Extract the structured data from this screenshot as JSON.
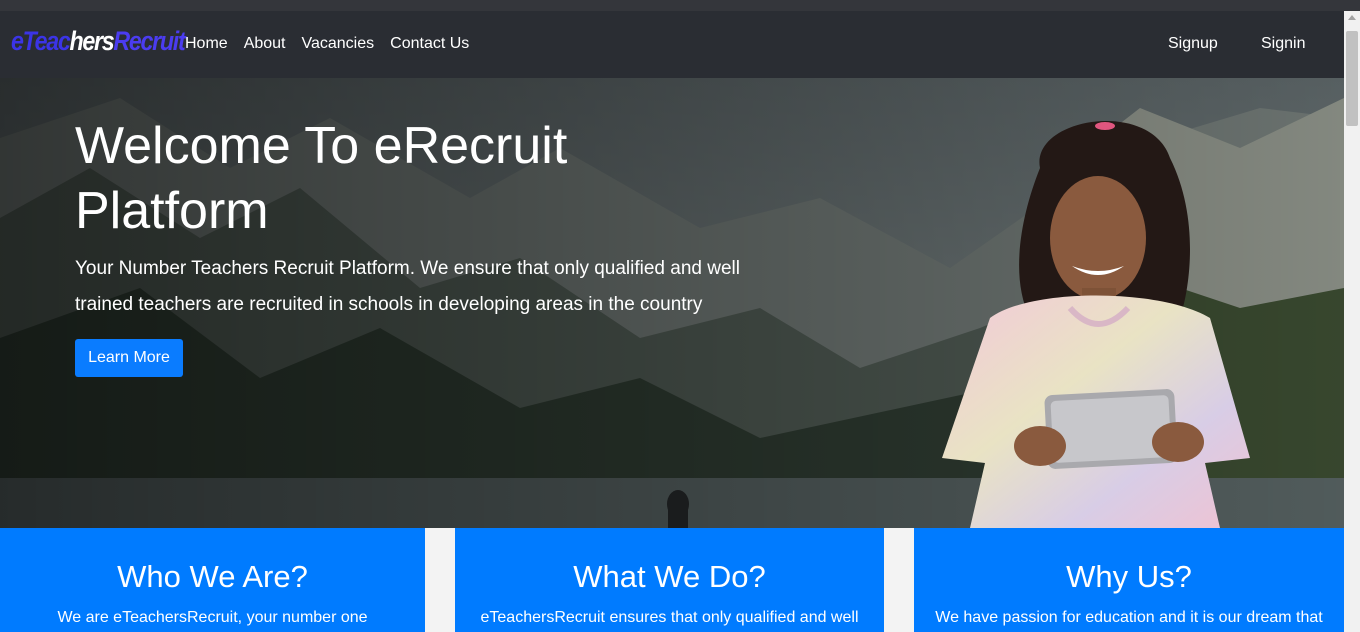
{
  "nav": {
    "brand": {
      "part1": "eTeac",
      "part2": "hers",
      "part3": "Recruit"
    },
    "links": [
      {
        "label": "Home"
      },
      {
        "label": "About"
      },
      {
        "label": "Vacancies"
      },
      {
        "label": "Contact Us"
      }
    ],
    "signup_label": "Signup",
    "signin_label": "Signin"
  },
  "hero": {
    "title": "Welcome To eRecruit Platform",
    "text": "Your Number Teachers Recruit Platform. We ensure that only qualified and well trained teachers are recruited in schools in developing areas in the country",
    "button_label": "Learn More"
  },
  "cards": [
    {
      "title": "Who We Are?",
      "text": "We are eTeachersRecruit, your number one"
    },
    {
      "title": "What We Do?",
      "text": "eTeachersRecruit ensures that only qualified and well"
    },
    {
      "title": "Why Us?",
      "text": "We have passion for education and it is our dream that"
    }
  ],
  "colors": {
    "navbar": "#2a2d33",
    "accent": "#007bff",
    "brand_blue": "#3b34e6"
  }
}
